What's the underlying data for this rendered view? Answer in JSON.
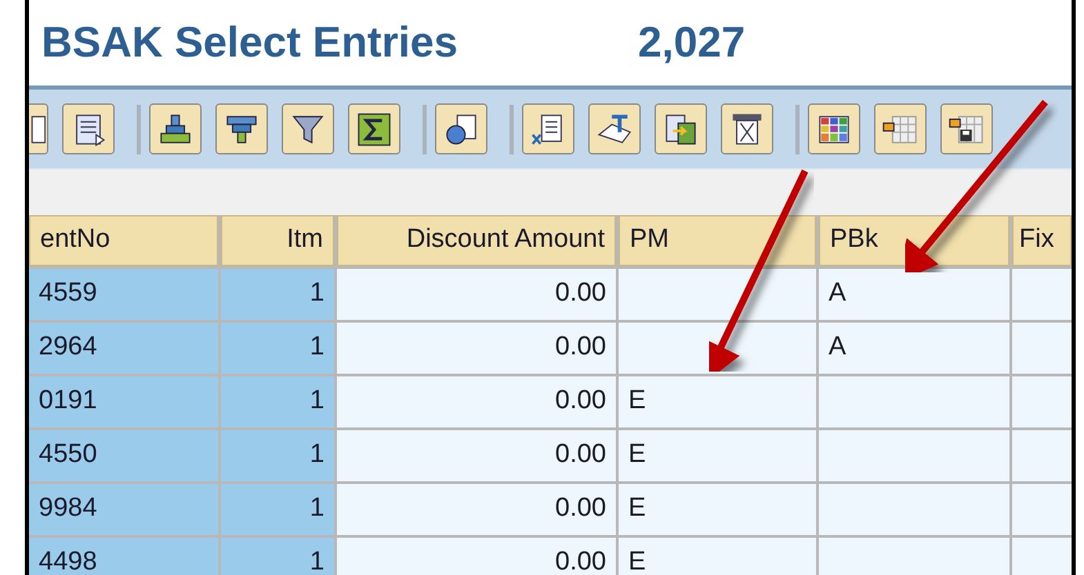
{
  "title": {
    "text": "BSAK Select Entries",
    "count": "2,027"
  },
  "table": {
    "columns": [
      "entNo",
      "Itm",
      "Discount Amount",
      "PM",
      "PBk",
      "Fix"
    ],
    "rows": [
      [
        "4559",
        "1",
        "0.00",
        "",
        "A",
        ""
      ],
      [
        "2964",
        "1",
        "0.00",
        "",
        "A",
        ""
      ],
      [
        "0191",
        "1",
        "0.00",
        "E",
        "",
        ""
      ],
      [
        "4550",
        "1",
        "0.00",
        "E",
        "",
        ""
      ],
      [
        "9984",
        "1",
        "0.00",
        "E",
        "",
        ""
      ],
      [
        "4498",
        "1",
        "0.00",
        "E",
        "",
        ""
      ]
    ]
  }
}
